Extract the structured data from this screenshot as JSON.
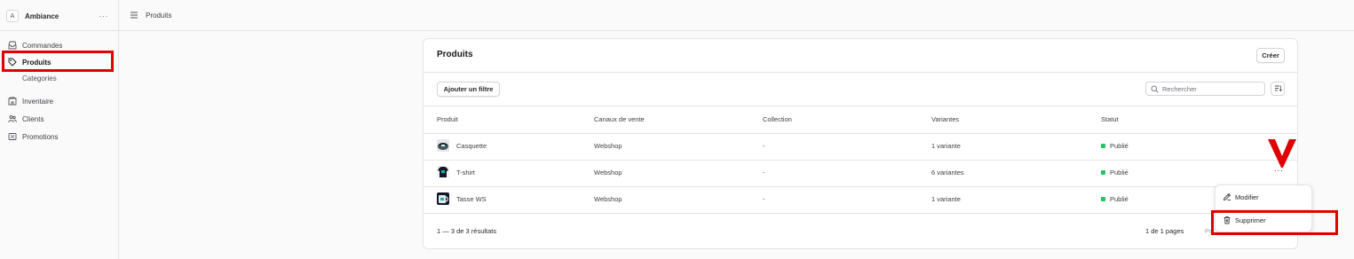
{
  "sidebar": {
    "store_initial": "A",
    "store_name": "Ambiance",
    "store_more": "···",
    "items": [
      {
        "label": "Commandes",
        "icon": "inbox-icon"
      },
      {
        "label": "Produits",
        "icon": "tag-icon"
      },
      {
        "label": "Categories",
        "icon": ""
      },
      {
        "label": "Inventaire",
        "icon": "building-icon"
      },
      {
        "label": "Clients",
        "icon": "users-icon"
      },
      {
        "label": "Promotions",
        "icon": "receipt-percent-icon"
      }
    ]
  },
  "topbar": {
    "breadcrumb": "Produits"
  },
  "products": {
    "title": "Produits",
    "create_label": "Créer",
    "add_filter_label": "Ajouter un filtre",
    "search_placeholder": "Rechercher",
    "columns": [
      "Produit",
      "Canaux de vente",
      "Collection",
      "Variantes",
      "Statut"
    ],
    "rows": [
      {
        "name": "Casquette",
        "channel": "Webshop",
        "collection": "-",
        "variants": "1 variante",
        "status": "Publié",
        "more": ""
      },
      {
        "name": "T-shirt",
        "channel": "Webshop",
        "collection": "-",
        "variants": "6 variantes",
        "status": "Publié",
        "more": "···"
      },
      {
        "name": "Tasse WS",
        "channel": "Webshop",
        "collection": "-",
        "variants": "1 variante",
        "status": "Publié",
        "more": ""
      }
    ],
    "results": "1 — 3 de 3 résultats",
    "pages": "1 de 1 pages",
    "prev": "Pr"
  },
  "dropdown": {
    "edit_label": "Modifier",
    "delete_label": "Supprimer"
  },
  "colors": {
    "status_published": "#22c55e",
    "highlight": "#e00000"
  }
}
